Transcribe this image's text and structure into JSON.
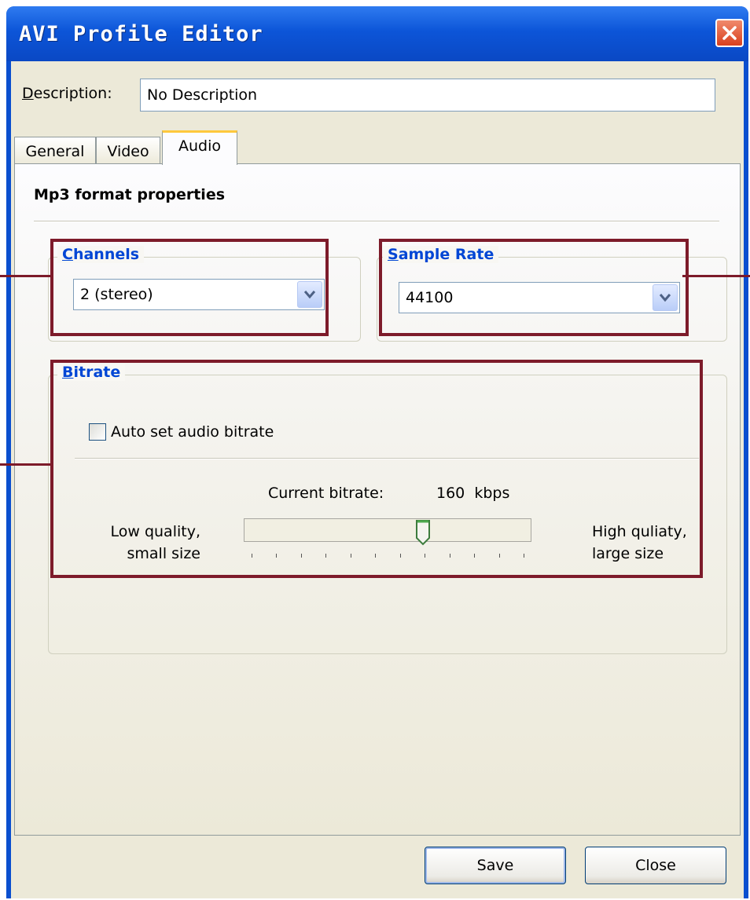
{
  "window": {
    "title": "AVI Profile Editor",
    "close_icon": "close-icon"
  },
  "description": {
    "label_accel": "D",
    "label_rest": "escription:",
    "value": "No Description"
  },
  "tabs": [
    {
      "label": "General",
      "active": false
    },
    {
      "label": "Video",
      "active": false
    },
    {
      "label": "Audio",
      "active": true
    }
  ],
  "audio": {
    "section_title": "Mp3 format properties",
    "channels": {
      "label_accel": "C",
      "label_rest": "hannels",
      "value": "2 (stereo)"
    },
    "sample_rate": {
      "label_accel": "S",
      "label_rest": "ample Rate",
      "value": "44100"
    },
    "bitrate": {
      "label_accel": "B",
      "label_rest": "itrate",
      "auto_label": "Auto set audio bitrate",
      "auto_checked": false,
      "current_label": "Current bitrate:",
      "current_value": "160",
      "current_unit": "kbps",
      "low_line1": "Low quality,",
      "low_line2": "small size",
      "high_line1": "High quliaty,",
      "high_line2": "large size",
      "slider_fraction": 0.63
    }
  },
  "buttons": {
    "save": "Save",
    "close": "Close"
  },
  "colors": {
    "titlebar": "#0a55d8",
    "group_label": "#0046d5",
    "highlight_box": "#7d1b2a"
  }
}
